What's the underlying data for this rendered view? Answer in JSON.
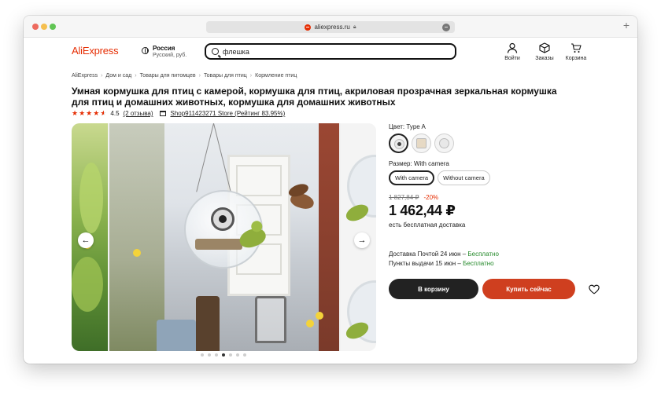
{
  "browser": {
    "url": "aliexpress.ru"
  },
  "header": {
    "logo": "AliExpress",
    "region_country": "Россия",
    "region_currency": "Русский, руб.",
    "search_value": "флешка",
    "login_label": "Войти",
    "orders_label": "Заказы",
    "cart_label": "Корзина"
  },
  "breadcrumb": [
    "AliExpress",
    "Дом и сад",
    "Товары для питомцев",
    "Товары для птиц",
    "Кормление птиц"
  ],
  "product": {
    "title": "Умная кормушка для птиц с камерой, кормушка для птиц, акриловая прозрачная зеркальная кормушка для птиц и домашних животных, кормушка для домашних животных",
    "rating": "4.5",
    "reviews": "(2 отзыва)",
    "store": "Shop911423271 Store (Рейтинг 83.95%)"
  },
  "gallery": {
    "prev_label": "←",
    "next_label": "→",
    "slide_count": 7,
    "active_slide": 3
  },
  "options": {
    "color_label": "Цвет: Type A",
    "size_label": "Размер: With camera",
    "sizes": [
      "With camera",
      "Without camera"
    ],
    "selected_size": 0,
    "selected_color": 0
  },
  "pricing": {
    "old_price": "1 827,84 ₽",
    "discount": "-20%",
    "price": "1 462,44 ₽",
    "shipping_note": "есть бесплатная доставка"
  },
  "delivery": {
    "line1_text": "Доставка Почтой 24 июн – ",
    "line1_free": "Бесплатно",
    "line2_text": "Пункты выдачи 15 июн – ",
    "line2_free": "Бесплатно"
  },
  "actions": {
    "cart_button": "В корзину",
    "buy_button": "Купить сейчас"
  },
  "colors": {
    "brand": "#e62e04",
    "buy_button": "#cf3f1f",
    "cart_button": "#222222",
    "free_text": "#24892a"
  },
  "icons": {
    "login": "user-icon",
    "orders": "box-icon",
    "cart": "cart-icon",
    "wishlist": "heart-icon",
    "search": "search-icon",
    "region": "globe-icon",
    "store": "store-icon"
  }
}
